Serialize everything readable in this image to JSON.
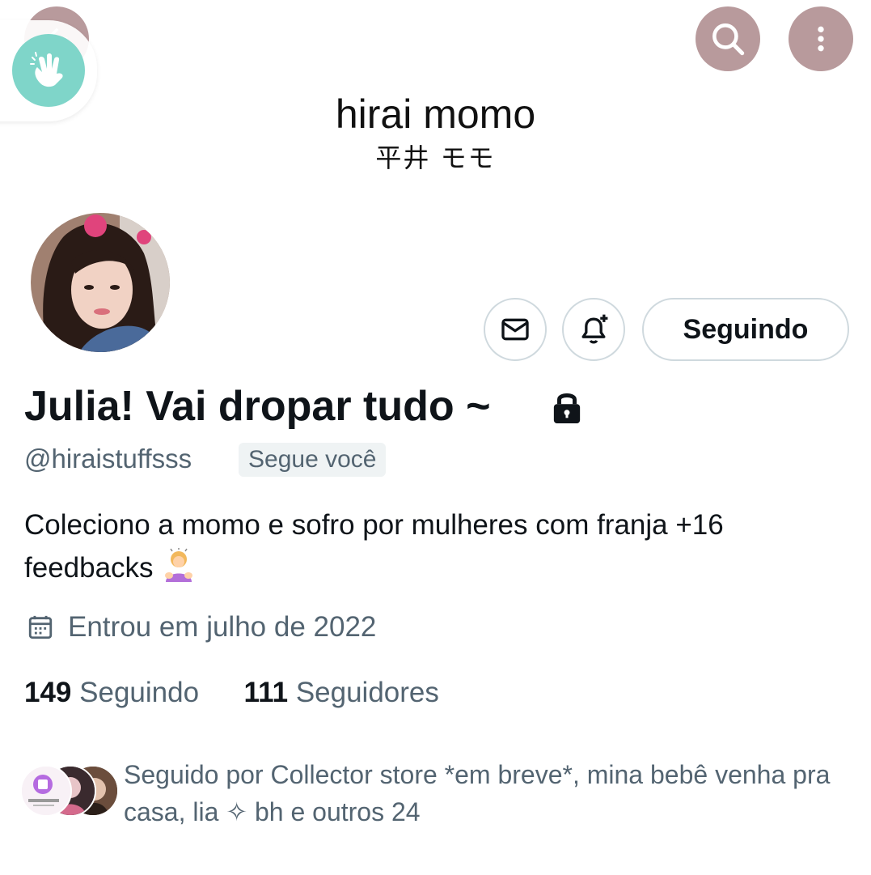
{
  "header": {
    "name": "hirai momo",
    "subtitle": "平井 モモ",
    "back_icon": "arrow-left-icon",
    "search_icon": "search-icon",
    "more_icon": "more-vertical-icon"
  },
  "profile": {
    "display_name": "Julia! Vai dropar tudo ~",
    "handle": "@hiraistuffsss",
    "follows_you": "Segue você",
    "bio_line1": "Coleciono a momo e sofro por mulheres com franja +16",
    "bio_line2": "feedbacks",
    "joined": "Entrou em julho de 2022",
    "following_count": "149",
    "following_label": "Seguindo",
    "followers_count": "111",
    "followers_label": "Seguidores",
    "followed_by": "Seguido por Collector store *em breve*, mina bebê venha pra casa, lia ✧ bh e outros 24"
  },
  "actions": {
    "follow_button": "Seguindo"
  },
  "colors": {
    "header_button": "#b89a9c",
    "wave_badge": "#7fd5c9",
    "secondary_text": "#536471",
    "primary_text": "#0f1419",
    "border": "#cfd9de"
  }
}
